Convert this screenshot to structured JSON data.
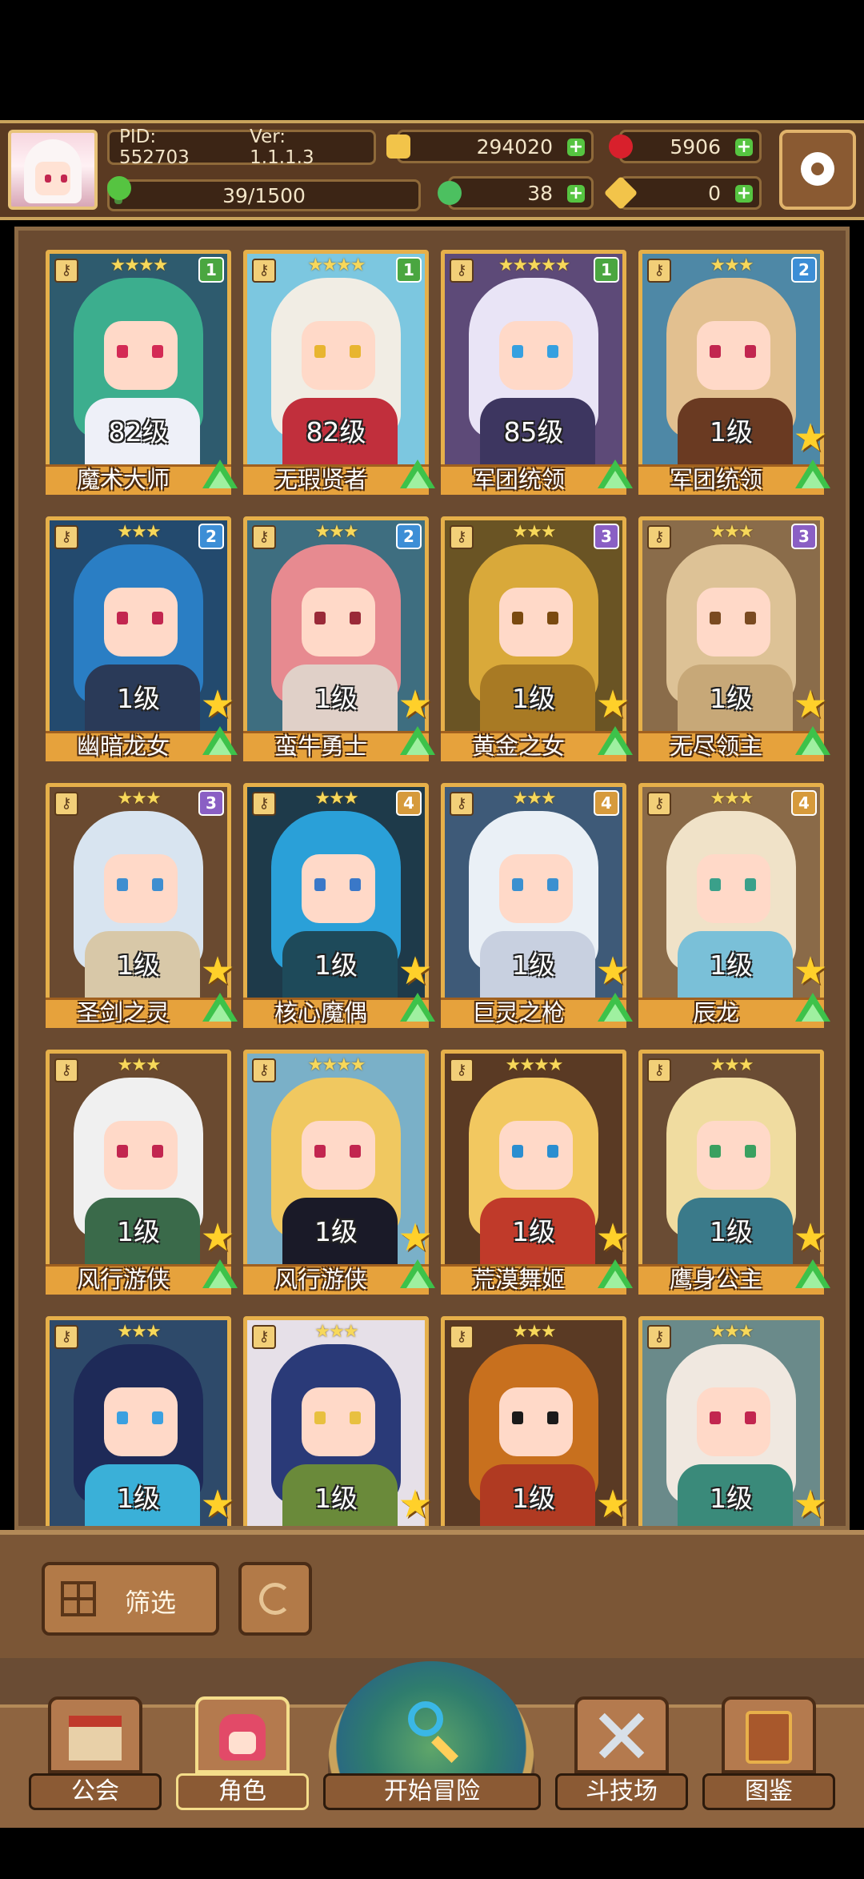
{
  "header": {
    "pid": "PID: 552703",
    "version": "Ver: 1.1.1.3",
    "exp": "39/1500",
    "exp_fraction": 0.026,
    "gold": "294020",
    "gems": "5906",
    "clover": "38",
    "keys": "0"
  },
  "cards": [
    {
      "name": "魔术大师",
      "level": "82级",
      "stars": "★★★★",
      "tier": "1",
      "tier_color": "#4aa640",
      "hair": "#3cae8e",
      "body": "#eef0f8",
      "eye": "#d42b55",
      "bg": "#2e5b6e",
      "has_star": false
    },
    {
      "name": "无瑕贤者",
      "level": "82级",
      "stars": "★★★★",
      "tier": "1",
      "tier_color": "#4aa640",
      "hair": "#f1ede4",
      "body": "#c12f3c",
      "eye": "#e8b530",
      "bg": "#7cc7e0",
      "has_star": false
    },
    {
      "name": "军团统领",
      "level": "85级",
      "stars": "★★★★★",
      "tier": "1",
      "tier_color": "#4aa640",
      "hair": "#e9e4f6",
      "body": "#3d3660",
      "eye": "#36a0e0",
      "bg": "#5d4a78",
      "has_star": false
    },
    {
      "name": "军团统领",
      "level": "1级",
      "stars": "★★★",
      "tier": "2",
      "tier_color": "#3c8ed6",
      "hair": "#e2c090",
      "body": "#6a3a22",
      "eye": "#c2264f",
      "bg": "#4e88a6",
      "has_star": true
    },
    {
      "name": "幽暗龙女",
      "level": "1级",
      "stars": "★★★",
      "tier": "2",
      "tier_color": "#3c8ed6",
      "hair": "#2a7ec4",
      "body": "#2a3a58",
      "eye": "#c2264f",
      "bg": "#234a6e",
      "has_star": true
    },
    {
      "name": "蛮牛勇士",
      "level": "1级",
      "stars": "★★★",
      "tier": "2",
      "tier_color": "#3c8ed6",
      "hair": "#e78a90",
      "body": "#e0d0c8",
      "eye": "#9a2a38",
      "bg": "#3e6e80",
      "has_star": true
    },
    {
      "name": "黄金之女",
      "level": "1级",
      "stars": "★★★",
      "tier": "3",
      "tier_color": "#8a5fc4",
      "hair": "#d9a93a",
      "body": "#a87a24",
      "eye": "#7a4a10",
      "bg": "#6a5424",
      "has_star": true
    },
    {
      "name": "无尽领主",
      "level": "1级",
      "stars": "★★★",
      "tier": "3",
      "tier_color": "#8a5fc4",
      "hair": "#ddc296",
      "body": "#c7a878",
      "eye": "#7a4a20",
      "bg": "#8a6c4a",
      "has_star": true
    },
    {
      "name": "圣剑之灵",
      "level": "1级",
      "stars": "★★★",
      "tier": "3",
      "tier_color": "#8a5fc4",
      "hair": "#d8e4f0",
      "body": "#d8c8a8",
      "eye": "#3e8ed0",
      "bg": "#6a4a30",
      "has_star": true
    },
    {
      "name": "核心魔偶",
      "level": "1级",
      "stars": "★★★",
      "tier": "4",
      "tier_color": "#d69a3c",
      "hair": "#2aa0d8",
      "body": "#1e4a5a",
      "eye": "#3a78c8",
      "bg": "#1e3a4a",
      "has_star": true
    },
    {
      "name": "巨灵之枪",
      "level": "1级",
      "stars": "★★★",
      "tier": "4",
      "tier_color": "#d69a3c",
      "hair": "#eaf0f6",
      "body": "#c8d0e0",
      "eye": "#3a90d0",
      "bg": "#3e5a78",
      "has_star": true
    },
    {
      "name": "辰龙",
      "level": "1级",
      "stars": "★★★",
      "tier": "4",
      "tier_color": "#d69a3c",
      "hair": "#f0e2c8",
      "body": "#7ac0d8",
      "eye": "#3aa08a",
      "bg": "#8a6a48",
      "has_star": true
    },
    {
      "name": "风行游侠",
      "level": "1级",
      "stars": "★★★",
      "tier": "",
      "tier_color": "",
      "hair": "#f0f0f0",
      "body": "#3a6a4a",
      "eye": "#c2264f",
      "bg": "#6a4a30",
      "has_star": true
    },
    {
      "name": "风行游侠",
      "level": "1级",
      "stars": "★★★★",
      "tier": "",
      "tier_color": "",
      "hair": "#f0c860",
      "body": "#1a1a28",
      "eye": "#c2264f",
      "bg": "#7ab0c8",
      "has_star": true
    },
    {
      "name": "荒漠舞姬",
      "level": "1级",
      "stars": "★★★★",
      "tier": "",
      "tier_color": "",
      "hair": "#f2c860",
      "body": "#c03a2a",
      "eye": "#2a8ed0",
      "bg": "#5a3a24",
      "has_star": true
    },
    {
      "name": "鹰身公主",
      "level": "1级",
      "stars": "★★★",
      "tier": "",
      "tier_color": "",
      "hair": "#f0dca0",
      "body": "#3a7a8a",
      "eye": "#3aa060",
      "bg": "#6a4c34",
      "has_star": true
    },
    {
      "name": "",
      "level": "1级",
      "stars": "★★★",
      "tier": "",
      "tier_color": "",
      "hair": "#1e2a58",
      "body": "#3ab0d8",
      "eye": "#3aa0e0",
      "bg": "#2e4a6a",
      "has_star": true
    },
    {
      "name": "",
      "level": "1级",
      "stars": "★★★",
      "tier": "",
      "tier_color": "",
      "hair": "#2a3a78",
      "body": "#6a8a3a",
      "eye": "#e8c040",
      "bg": "#e6e0e8",
      "has_star": true
    },
    {
      "name": "",
      "level": "1级",
      "stars": "★★★",
      "tier": "",
      "tier_color": "",
      "hair": "#c8701e",
      "body": "#b03a22",
      "eye": "#1a1a1a",
      "bg": "#5a3a24",
      "has_star": true
    },
    {
      "name": "",
      "level": "1级",
      "stars": "★★★",
      "tier": "",
      "tier_color": "",
      "hair": "#f0e8e0",
      "body": "#3a8a7a",
      "eye": "#c2264f",
      "bg": "#6a8a8a",
      "has_star": true
    }
  ],
  "controls": {
    "filter_label": "筛选"
  },
  "nav": {
    "guild": "公会",
    "characters": "角色",
    "adventure": "开始冒险",
    "arena": "斗技场",
    "codex": "图鉴"
  }
}
